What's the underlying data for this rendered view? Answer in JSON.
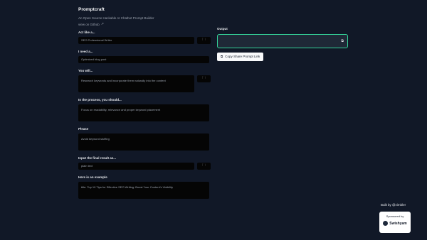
{
  "app": {
    "title": "Promptcraft",
    "subtitle": "An Open Source Hackable AI Chatbot Prompt Builder",
    "github_link": "view on Github"
  },
  "form": {
    "fields": [
      {
        "label": "Act like a...",
        "value": "SEO Professional Writer"
      },
      {
        "label": "I need a...",
        "value": "Optimized blog post"
      },
      {
        "label": "You will...",
        "value": "Research keywords and incorporate them naturally into the content"
      },
      {
        "label": "In the process, you should...",
        "value": "Focus on readability, relevance and proper keyword placement"
      },
      {
        "label": "Please",
        "value": "Avoid keyword stuffing"
      },
      {
        "label": "Input the final result as...",
        "value": "plain text"
      },
      {
        "label": "Here is an example",
        "value": "title: Top 10 Tips for Effective SEO Writing: Boost Your Content's Visibility"
      }
    ]
  },
  "output": {
    "label": "Output",
    "value": "",
    "share_button": "Copy Share Prompt Link"
  },
  "footer": {
    "built_by": "Built by @zimbler",
    "sponsored_label": "Sponsored by",
    "sponsor_name": "Swishyam"
  },
  "icons": {
    "file": "file-icon",
    "copy": "copy-icon",
    "external": "external-link-icon"
  },
  "colors": {
    "background": "#111827",
    "accent": "#34d399",
    "input_bg": "#050505"
  }
}
